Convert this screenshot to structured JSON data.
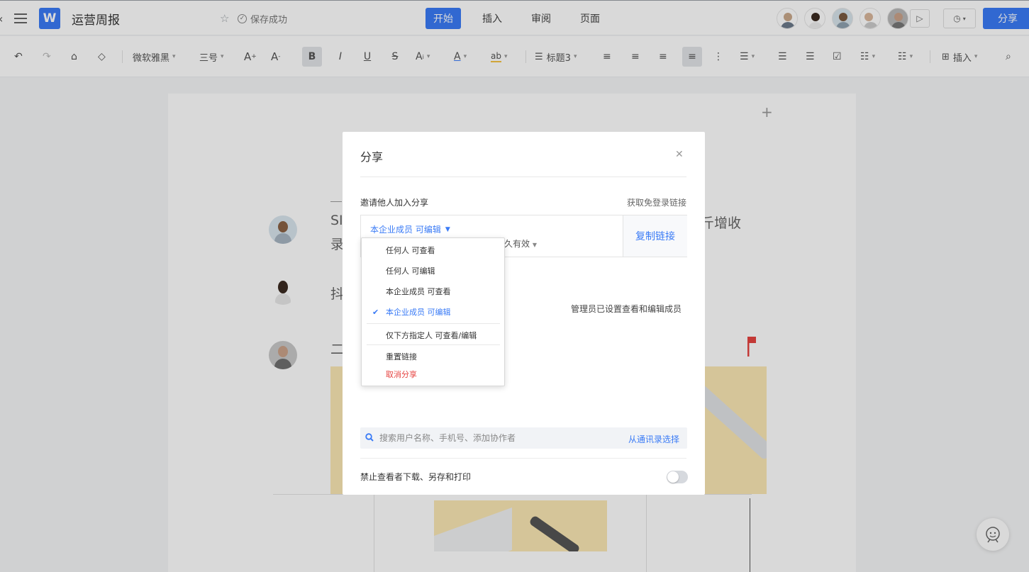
{
  "header": {
    "back_icon": "chevron-left-icon",
    "logo_letter": "W",
    "doc_title": "运营周报",
    "save_status": "保存成功",
    "tabs": [
      {
        "label": "开始",
        "active": true
      },
      {
        "label": "插入",
        "active": false
      },
      {
        "label": "审阅",
        "active": false
      },
      {
        "label": "页面",
        "active": false
      }
    ],
    "share_label": "分享",
    "accent_color": "#3a7bf6"
  },
  "toolbar": {
    "font_family": "微软雅黑",
    "font_size": "三号",
    "heading_style": "标题3",
    "insert_label": "插入"
  },
  "document": {
    "line1": "SI",
    "line1b": "录",
    "line1_right": "斤增收",
    "line2": "抖",
    "line3": "二"
  },
  "share_modal": {
    "title": "分享",
    "invite_label": "邀请他人加入分享",
    "no_login_link": "获取免登录链接",
    "link_permission": "本企业成员 可编辑",
    "link_expiry": "久有效",
    "copy_link": "复制链接",
    "admin_note": "管理员已设置查看和编辑成员",
    "search_placeholder": "搜索用户名称、手机号、添加协作者",
    "contacts_link": "从通讯录选择",
    "forbid_download_label": "禁止查看者下载、另存和打印",
    "forbid_download_enabled": false
  },
  "permission_dropdown": {
    "items": [
      {
        "label": "任何人 可查看",
        "selected": false
      },
      {
        "label": "任何人 可编辑",
        "selected": false
      },
      {
        "label": "本企业成员 可查看",
        "selected": false
      },
      {
        "label": "本企业成员 可编辑",
        "selected": true
      },
      {
        "label": "仅下方指定人 可查看/编辑",
        "selected": false
      },
      {
        "label": "重置链接",
        "selected": false
      },
      {
        "label": "取消分享",
        "selected": false,
        "danger": true
      }
    ]
  }
}
